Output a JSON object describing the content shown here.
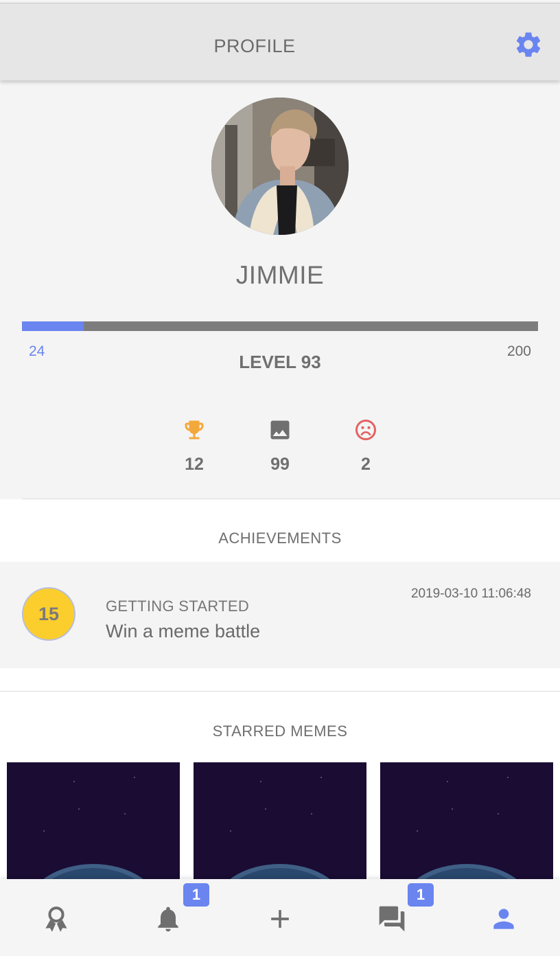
{
  "header": {
    "title": "PROFILE",
    "settings_icon": "gear-icon"
  },
  "profile": {
    "username": "JIMMIE",
    "xp_current": "24",
    "xp_max": "200",
    "xp_progress": 0.12,
    "level_label": "LEVEL 93"
  },
  "stats": [
    {
      "icon": "trophy-icon",
      "value": "12",
      "color": "#f3a83b"
    },
    {
      "icon": "image-icon",
      "value": "99",
      "color": "#6f6f6f"
    },
    {
      "icon": "sad-face-icon",
      "value": "2",
      "color": "#e46262"
    }
  ],
  "achievements": {
    "title": "ACHIEVEMENTS",
    "items": [
      {
        "badge": "15",
        "title": "GETTING STARTED",
        "description": "Win a meme battle",
        "date": "2019-03-10 11:06:48"
      }
    ]
  },
  "starred": {
    "title": "STARRED MEMES",
    "count_visible": 3
  },
  "nav": {
    "items": [
      {
        "name": "achievements",
        "icon": "award-icon"
      },
      {
        "name": "notifications",
        "icon": "bell-icon",
        "badge": "1"
      },
      {
        "name": "create",
        "icon": "plus-icon"
      },
      {
        "name": "messages",
        "icon": "chat-icon",
        "badge": "1"
      },
      {
        "name": "profile",
        "icon": "person-icon",
        "active": true
      }
    ]
  },
  "colors": {
    "accent": "#6a85ef",
    "badge_yellow": "#fbce2e",
    "header_bg": "#e6e6e6"
  }
}
